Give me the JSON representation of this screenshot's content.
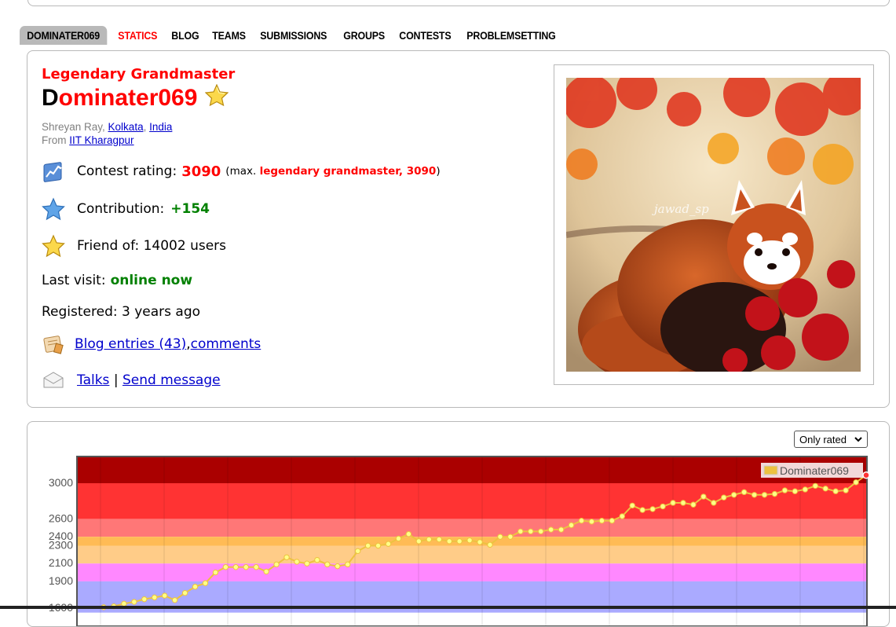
{
  "nav": {
    "tabs": [
      {
        "label": "DOMINATER069",
        "active": true
      },
      {
        "label": "STATICS",
        "red": true
      },
      {
        "label": "BLOG"
      },
      {
        "label": "TEAMS"
      },
      {
        "label": "SUBMISSIONS"
      },
      {
        "label": "GROUPS"
      },
      {
        "label": "CONTESTS"
      },
      {
        "label": "PROBLEMSETTING"
      }
    ]
  },
  "profile": {
    "rank": "Legendary Grandmaster",
    "handle_first": "D",
    "handle_rest": "ominater069",
    "name": "Shreyan Ray, ",
    "city": "Kolkata",
    "sep": ", ",
    "country": "India",
    "from_label": "From ",
    "org": "IIT Kharagpur",
    "contest_rating_label": "Contest rating:",
    "contest_rating": "3090",
    "max_open": "(max. ",
    "max_value": "legendary grandmaster, 3090",
    "max_close": ")",
    "contribution_label": "Contribution:",
    "contribution": "+154",
    "friend_label": "Friend of: 14002 users",
    "last_visit_label": "Last visit: ",
    "last_visit": "online now",
    "registered": "Registered: 3 years ago",
    "blog_link": "Blog entries (43)",
    "comma": ", ",
    "comments_link": "comments",
    "talks_link": "Talks",
    "pipe": " | ",
    "send_message_link": "Send message",
    "photo_watermark": "jawad_sp"
  },
  "graph": {
    "filter_select": "Only rated"
  },
  "chart_data": {
    "type": "line",
    "series": [
      {
        "name": "Dominater069",
        "color": "#edc240"
      }
    ],
    "yticks": [
      "3000",
      "2600",
      "2400",
      "2300",
      "2100",
      "1900",
      "1600"
    ],
    "ylim": [
      1550,
      3300
    ],
    "bands": [
      {
        "from": 3000,
        "to": 3300,
        "color": "#ff3333"
      },
      {
        "from": 2600,
        "to": 3000,
        "color": "#ff3333"
      },
      {
        "from": 2400,
        "to": 2600,
        "color": "#ff7777"
      },
      {
        "from": 2300,
        "to": 2400,
        "color": "#ffbb55"
      },
      {
        "from": 2100,
        "to": 2300,
        "color": "#ffcc88"
      },
      {
        "from": 1900,
        "to": 2100,
        "color": "#ff88ff"
      },
      {
        "from": 1550,
        "to": 1900,
        "color": "#aaaaff"
      }
    ],
    "top_band": {
      "from": 3000,
      "to": 3300,
      "color": "#aa0000"
    },
    "values": [
      1610,
      1620,
      1650,
      1670,
      1700,
      1720,
      1740,
      1690,
      1770,
      1840,
      1880,
      2000,
      2060,
      2060,
      2060,
      2060,
      2010,
      2090,
      2170,
      2120,
      2100,
      2140,
      2090,
      2070,
      2090,
      2240,
      2300,
      2300,
      2320,
      2380,
      2430,
      2350,
      2370,
      2370,
      2350,
      2350,
      2360,
      2340,
      2310,
      2400,
      2400,
      2460,
      2460,
      2460,
      2480,
      2480,
      2530,
      2580,
      2570,
      2580,
      2580,
      2630,
      2750,
      2700,
      2710,
      2740,
      2780,
      2780,
      2760,
      2850,
      2780,
      2840,
      2870,
      2900,
      2870,
      2870,
      2880,
      2920,
      2910,
      2930,
      2970,
      2940,
      2910,
      2920,
      3010,
      3090
    ]
  }
}
